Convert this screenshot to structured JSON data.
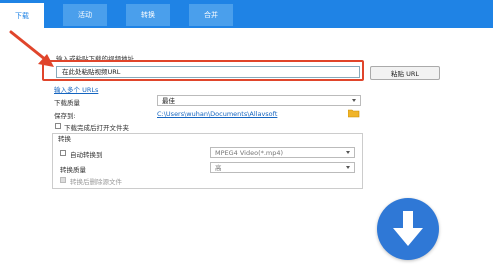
{
  "tabs": [
    {
      "label": "下载"
    },
    {
      "label": "活动"
    },
    {
      "label": "转换"
    },
    {
      "label": "合并"
    }
  ],
  "url_section": {
    "label": "输入或粘贴下载的视频地址",
    "value": "在此处粘贴视频URL",
    "paste_button": "粘贴 URL"
  },
  "multi_urls_link": "输入多个 URLs",
  "quality": {
    "label": "下载质量",
    "value": "最佳"
  },
  "save": {
    "label": "保存到:",
    "path": "C:\\Users\\wuhan\\Documents\\Allavsoft"
  },
  "open_folder": {
    "label": "下载完成后打开文件夹"
  },
  "convert": {
    "section_label": "转换",
    "auto_label": "自动转换到",
    "format": "MPEG4 Video(*.mp4)",
    "quality_label": "转换质量",
    "quality_value": "高",
    "delete_label": "转换后删除源文件"
  },
  "colors": {
    "tabbar": "#1f83e5",
    "arrow": "#e0452b",
    "download_button": "#2f78d6"
  }
}
